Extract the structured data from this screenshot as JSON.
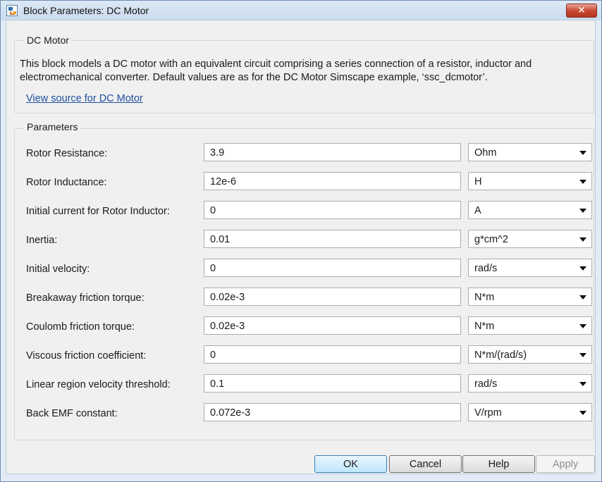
{
  "window": {
    "title": "Block Parameters: DC Motor",
    "close_label": "✕"
  },
  "block": {
    "group_title": "DC Motor",
    "description": "This block models a DC motor with an equivalent circuit comprising a series connection of a resistor, inductor and electromechanical converter. Default values are as for the DC Motor Simscape example, ‘ssc_dcmotor’.",
    "source_link": "View source for DC Motor"
  },
  "parameters": {
    "group_title": "Parameters",
    "rows": [
      {
        "label": "Rotor Resistance:",
        "value": "3.9",
        "unit": "Ohm"
      },
      {
        "label": "Rotor Inductance:",
        "value": "12e-6",
        "unit": "H"
      },
      {
        "label": "Initial current for Rotor Inductor:",
        "value": "0",
        "unit": "A"
      },
      {
        "label": "Inertia:",
        "value": "0.01",
        "unit": "g*cm^2"
      },
      {
        "label": "Initial velocity:",
        "value": "0",
        "unit": "rad/s"
      },
      {
        "label": "Breakaway friction torque:",
        "value": "0.02e-3",
        "unit": "N*m"
      },
      {
        "label": "Coulomb friction torque:",
        "value": "0.02e-3",
        "unit": "N*m"
      },
      {
        "label": "Viscous friction coefficient:",
        "value": "0",
        "unit": "N*m/(rad/s)"
      },
      {
        "label": "Linear region velocity threshold:",
        "value": "0.1",
        "unit": "rad/s"
      },
      {
        "label": "Back EMF constant:",
        "value": "0.072e-3",
        "unit": "V/rpm"
      }
    ]
  },
  "buttons": {
    "ok": "OK",
    "cancel": "Cancel",
    "help": "Help",
    "apply": "Apply"
  },
  "colors": {
    "link": "#1f4fa0",
    "close_button": "#c7442e",
    "default_button_border": "#3c7fb1"
  },
  "icons": {
    "app": "simulink-block-icon",
    "close": "close-icon",
    "dropdown": "chevron-down-icon"
  }
}
